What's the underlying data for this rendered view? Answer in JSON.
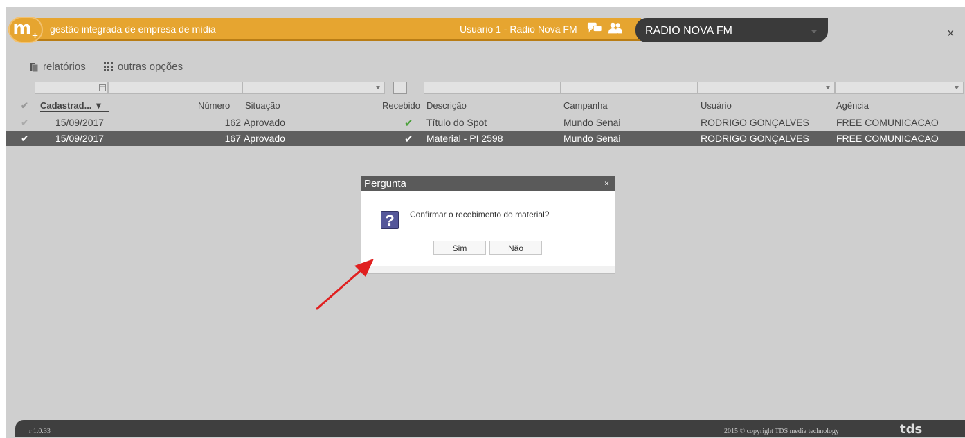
{
  "header": {
    "app_title": "gestão integrada de empresa de mídia",
    "user": "Usuario 1 - Radio Nova FM",
    "station": "RADIO NOVA FM",
    "close_symbol": "×",
    "logo_text": "m",
    "logo_plus": "+"
  },
  "toolbar": {
    "reports_label": "relatórios",
    "options_label": "outras opções"
  },
  "grid": {
    "columns": [
      "Cadastrad...",
      "Número",
      "Situação",
      "Recebido",
      "Descrição",
      "Campanha",
      "Usuário",
      "Agência"
    ],
    "rows": [
      {
        "date": "15/09/2017",
        "number": "162",
        "status": "Aprovado",
        "received": "✔",
        "description": "Título do Spot",
        "campaign": "Mundo Senai",
        "user": "RODRIGO GONÇALVES",
        "agency": "FREE COMUNICACAO"
      },
      {
        "date": "15/09/2017",
        "number": "167",
        "status": "Aprovado",
        "received": "✔",
        "description": "Material - PI 2598",
        "campaign": "Mundo Senai",
        "user": "RODRIGO GONÇALVES",
        "agency": "FREE COMUNICACAO"
      }
    ]
  },
  "dialog": {
    "title": "Pergunta",
    "close_symbol": "×",
    "icon_symbol": "?",
    "message": "Confirmar o recebimento do material?",
    "yes_label": "Sim",
    "no_label": "Não"
  },
  "footer": {
    "version": "r 1.0.33",
    "copyright": "2015 © copyright TDS media technology",
    "brand": "tds"
  },
  "colors": {
    "header_orange": "#e6a530",
    "header_dark": "#3a3a3a",
    "selected_row": "#5f5f5f",
    "check_green": "#4aa03a",
    "annotation_arrow": "#e02020"
  },
  "icons": [
    "logo-icon",
    "chat-icon",
    "users-icon",
    "reports-icon",
    "grid-options-icon",
    "calendar-icon",
    "check-icon",
    "question-icon",
    "close-icon",
    "arrow-annotation"
  ]
}
